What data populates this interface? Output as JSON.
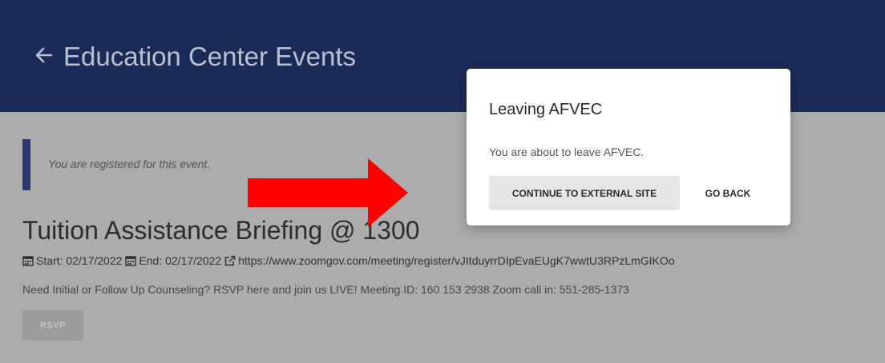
{
  "header": {
    "back_icon": "arrow-left-icon",
    "title": "Education Center Events",
    "background": "#1b2b57"
  },
  "notice": {
    "text": "You are registered for this event."
  },
  "event": {
    "title": "Tuition Assistance Briefing @ 1300",
    "start_label": "Start: 02/17/2022",
    "end_label": "End: 02/17/2022",
    "link": "https://www.zoomgov.com/meeting/register/vJItduyrrDIpEvaEUgK7wwtU3RPzLmGIKOo",
    "description": "Need Initial or Follow Up Counseling? RSVP here and join us LIVE! Meeting ID: 160 153 2938 Zoom call in: 551-285-1373",
    "rsvp_label": "RSVP"
  },
  "annotation": {
    "arrow_color": "#ff0000"
  },
  "modal": {
    "title": "Leaving AFVEC",
    "body": "You are about to leave AFVEC.",
    "continue_label": "CONTINUE TO EXTERNAL SITE",
    "back_label": "GO BACK"
  }
}
